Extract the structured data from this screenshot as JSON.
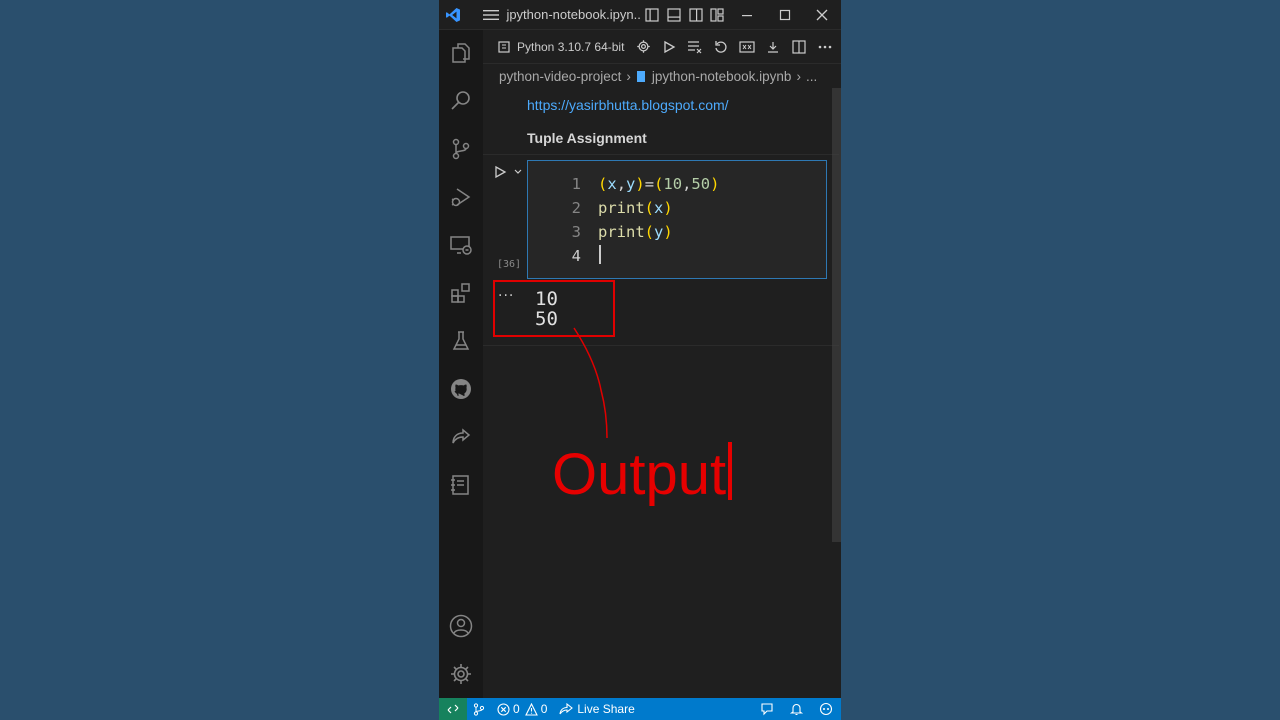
{
  "window": {
    "title": "jpython-notebook.ipyn..."
  },
  "toolbar": {
    "kernel_label": "Python 3.10.7 64-bit"
  },
  "breadcrumb": {
    "folder": "python-video-project",
    "file": "jpython-notebook.ipynb",
    "more": "..."
  },
  "markdown": {
    "link": "https://yasirbhutta.blogspot.com/",
    "heading": "Tuple Assignment"
  },
  "code_cell": {
    "execution_count": "[36]",
    "line_numbers": [
      "1",
      "2",
      "3",
      "4"
    ]
  },
  "output": {
    "more": "···",
    "lines": [
      "10",
      "50"
    ]
  },
  "annotation": {
    "text": "Output"
  },
  "statusbar": {
    "errors": "0",
    "warnings": "0",
    "live_share": "Live Share"
  },
  "colors": {
    "statusbar_bg": "#007acc",
    "remote_bg": "#16825d",
    "annotation": "#e60000",
    "cell_border": "#2e78b3",
    "link": "#4daafc"
  },
  "icons": {
    "activity_bar": [
      "files-icon",
      "search-icon",
      "source-control-icon",
      "run-debug-icon",
      "remote-explorer-icon",
      "extensions-icon",
      "testing-icon",
      "github-icon",
      "live-share-icon",
      "notebook-icon",
      "account-icon",
      "settings-gear-icon"
    ]
  }
}
